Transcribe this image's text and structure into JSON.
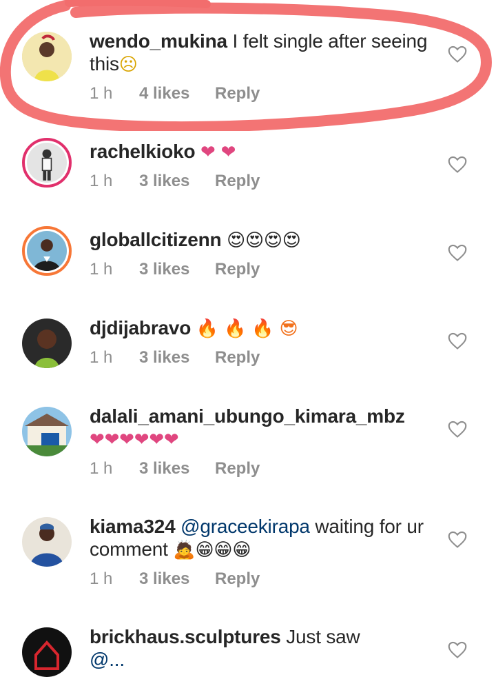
{
  "comments": [
    {
      "username": "wendo_mukina",
      "text": "I felt single after seeing this",
      "emoji": "☹",
      "time": "1 h",
      "likes": "4 likes",
      "reply": "Reply"
    },
    {
      "username": "rachelkioko",
      "text": "",
      "emoji": "❤ ❤",
      "time": "1 h",
      "likes": "3 likes",
      "reply": "Reply"
    },
    {
      "username": "globallcitizenn",
      "text": "",
      "emoji": "😍😍😍😍",
      "time": "1 h",
      "likes": "3 likes",
      "reply": "Reply"
    },
    {
      "username": "djdijabravo",
      "text": "",
      "emoji": "🔥 🔥 🔥 😎",
      "time": "1 h",
      "likes": "3 likes",
      "reply": "Reply"
    },
    {
      "username": "dalali_amani_ubungo_kimara_mbz",
      "text": "",
      "emoji": "❤❤❤❤❤❤",
      "time": "1 h",
      "likes": "3 likes",
      "reply": "Reply"
    },
    {
      "username": "kiama324",
      "mention": "@graceekirapa",
      "text": " waiting for ur comment",
      "emoji": "🙇😁😁😁",
      "time": "1 h",
      "likes": "3 likes",
      "reply": "Reply"
    },
    {
      "username": "brickhaus.sculptures",
      "text": "Just saw",
      "text2": "@..."
    }
  ],
  "colors": {
    "accent_ring": "#e1306c",
    "mention": "#00376b",
    "meta": "#8e8e8e",
    "annotation": "#f26d6d"
  }
}
